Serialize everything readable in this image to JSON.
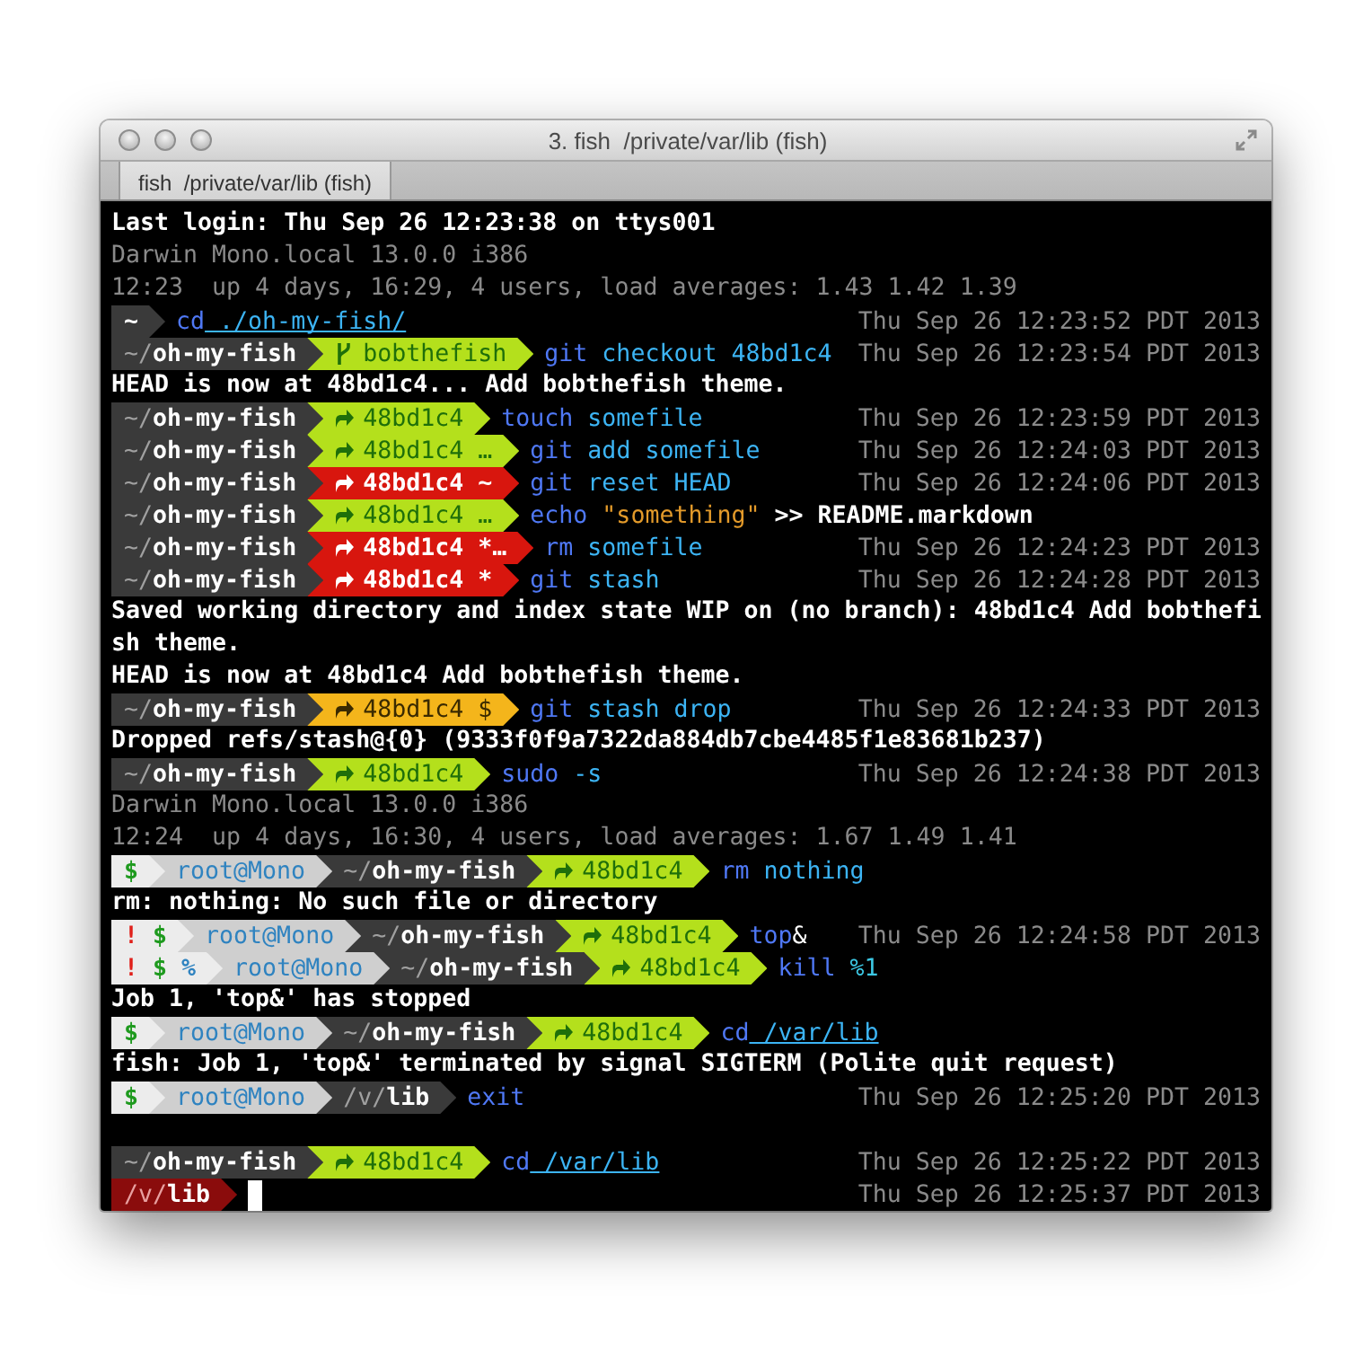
{
  "window": {
    "title": "3. fish  /private/var/lib (fish)"
  },
  "tabs": [
    {
      "label": "fish  /private/var/lib (fish)",
      "selected": true
    }
  ],
  "lines": [
    {
      "kind": "output",
      "text": "Last login: Thu Sep 26 12:23:38 on ttys001"
    },
    {
      "kind": "info",
      "text": "Darwin Mono.local 13.0.0 i386"
    },
    {
      "kind": "info",
      "text": "12:23  up 4 days, 16:29, 4 users, load averages: 1.43 1.42 1.39"
    },
    {
      "kind": "prompt",
      "segments": [
        {
          "kind": "cwd",
          "text": "**~**"
        }
      ],
      "tokens": [
        {
          "kind": "command",
          "text": "cd"
        },
        {
          "kind": "path",
          "text": " ./oh-my-fish/"
        }
      ],
      "time": "Thu Sep 26 12:23:52 PDT 2013"
    },
    {
      "kind": "prompt",
      "segments": [
        {
          "kind": "cwd",
          "text": "~/**oh-my-fish**"
        },
        {
          "kind": "git-clean",
          "detached": false,
          "text": "bobthefish"
        }
      ],
      "tokens": [
        {
          "kind": "command",
          "text": "git"
        },
        {
          "kind": "argument",
          "text": " checkout 48bd1c4"
        }
      ],
      "time": "Thu Sep 26 12:23:54 PDT 2013"
    },
    {
      "kind": "output",
      "text": "HEAD is now at 48bd1c4... Add bobthefish theme."
    },
    {
      "kind": "prompt",
      "segments": [
        {
          "kind": "cwd",
          "text": "~/**oh-my-fish**"
        },
        {
          "kind": "git-clean",
          "detached": true,
          "text": "48bd1c4"
        }
      ],
      "tokens": [
        {
          "kind": "command",
          "text": "touch"
        },
        {
          "kind": "argument",
          "text": " somefile"
        }
      ],
      "time": "Thu Sep 26 12:23:59 PDT 2013"
    },
    {
      "kind": "prompt",
      "segments": [
        {
          "kind": "cwd",
          "text": "~/**oh-my-fish**"
        },
        {
          "kind": "git-clean",
          "detached": true,
          "text": "48bd1c4 …"
        }
      ],
      "tokens": [
        {
          "kind": "command",
          "text": "git"
        },
        {
          "kind": "argument",
          "text": " add somefile"
        }
      ],
      "time": "Thu Sep 26 12:24:03 PDT 2013"
    },
    {
      "kind": "prompt",
      "segments": [
        {
          "kind": "cwd",
          "text": "~/**oh-my-fish**"
        },
        {
          "kind": "git-dirty",
          "detached": true,
          "text": "48bd1c4 ~"
        }
      ],
      "tokens": [
        {
          "kind": "command",
          "text": "git"
        },
        {
          "kind": "argument",
          "text": " reset HEAD"
        }
      ],
      "time": "Thu Sep 26 12:24:06 PDT 2013"
    },
    {
      "kind": "prompt",
      "segments": [
        {
          "kind": "cwd",
          "text": "~/**oh-my-fish**"
        },
        {
          "kind": "git-clean",
          "detached": true,
          "text": "48bd1c4 …"
        }
      ],
      "tokens": [
        {
          "kind": "command",
          "text": "echo"
        },
        {
          "kind": "string",
          "text": " \"something\""
        },
        {
          "kind": "redirect",
          "text": " >> README.markdown"
        }
      ]
    },
    {
      "kind": "prompt",
      "segments": [
        {
          "kind": "cwd",
          "text": "~/**oh-my-fish**"
        },
        {
          "kind": "git-dirty",
          "detached": true,
          "text": "48bd1c4 *…"
        }
      ],
      "tokens": [
        {
          "kind": "command",
          "text": "rm"
        },
        {
          "kind": "argument",
          "text": " somefile"
        }
      ],
      "time": "Thu Sep 26 12:24:23 PDT 2013"
    },
    {
      "kind": "prompt",
      "segments": [
        {
          "kind": "cwd",
          "text": "~/**oh-my-fish**"
        },
        {
          "kind": "git-dirty",
          "detached": true,
          "text": "48bd1c4 *"
        }
      ],
      "tokens": [
        {
          "kind": "command",
          "text": "git"
        },
        {
          "kind": "argument",
          "text": " stash"
        }
      ],
      "time": "Thu Sep 26 12:24:28 PDT 2013"
    },
    {
      "kind": "output",
      "text": "Saved working directory and index state WIP on (no branch): 48bd1c4 Add bobthefi"
    },
    {
      "kind": "output",
      "text": "sh theme."
    },
    {
      "kind": "output",
      "text": "HEAD is now at 48bd1c4 Add bobthefish theme."
    },
    {
      "kind": "prompt",
      "segments": [
        {
          "kind": "cwd",
          "text": "~/**oh-my-fish**"
        },
        {
          "kind": "git-stashed",
          "detached": true,
          "text": "48bd1c4 $"
        }
      ],
      "tokens": [
        {
          "kind": "command",
          "text": "git"
        },
        {
          "kind": "argument",
          "text": " stash drop"
        }
      ],
      "time": "Thu Sep 26 12:24:33 PDT 2013"
    },
    {
      "kind": "output",
      "text": "Dropped refs/stash@{0} (9333f0f9a7322da884db7cbe4485f1e83681b237)"
    },
    {
      "kind": "prompt",
      "segments": [
        {
          "kind": "cwd",
          "text": "~/**oh-my-fish**"
        },
        {
          "kind": "git-clean",
          "detached": true,
          "text": "48bd1c4"
        }
      ],
      "tokens": [
        {
          "kind": "command",
          "text": "sudo"
        },
        {
          "kind": "argument",
          "text": " -s"
        }
      ],
      "time": "Thu Sep 26 12:24:38 PDT 2013"
    },
    {
      "kind": "info",
      "text": "Darwin Mono.local 13.0.0 i386"
    },
    {
      "kind": "info",
      "text": "12:24  up 4 days, 16:30, 4 users, load averages: 1.67 1.49 1.41"
    },
    {
      "kind": "prompt",
      "segments": [
        {
          "kind": "status",
          "marks": [
            {
              "text": "$",
              "color": "#1e9a1e"
            }
          ]
        },
        {
          "kind": "user",
          "text": "root@Mono"
        },
        {
          "kind": "cwd",
          "text": "~/**oh-my-fish**"
        },
        {
          "kind": "git-clean",
          "detached": true,
          "text": "48bd1c4"
        }
      ],
      "tokens": [
        {
          "kind": "command",
          "text": "rm"
        },
        {
          "kind": "argument",
          "text": " nothing"
        }
      ]
    },
    {
      "kind": "output",
      "text": "rm: nothing: No such file or directory"
    },
    {
      "kind": "prompt",
      "segments": [
        {
          "kind": "status",
          "marks": [
            {
              "text": "!",
              "color": "#e0201a"
            },
            {
              "text": "$",
              "color": "#1e9a1e"
            }
          ]
        },
        {
          "kind": "user",
          "text": "root@Mono"
        },
        {
          "kind": "cwd",
          "text": "~/**oh-my-fish**"
        },
        {
          "kind": "git-clean",
          "detached": true,
          "text": "48bd1c4"
        }
      ],
      "tokens": [
        {
          "kind": "command",
          "text": "top"
        },
        {
          "kind": "operator",
          "text": "&"
        }
      ],
      "time": "Thu Sep 26 12:24:58 PDT 2013"
    },
    {
      "kind": "prompt",
      "segments": [
        {
          "kind": "status",
          "marks": [
            {
              "text": "!",
              "color": "#e0201a"
            },
            {
              "text": "$",
              "color": "#1e9a1e"
            },
            {
              "text": "%",
              "color": "#2f83c0"
            }
          ]
        },
        {
          "kind": "user",
          "text": "root@Mono"
        },
        {
          "kind": "cwd",
          "text": "~/**oh-my-fish**"
        },
        {
          "kind": "git-clean",
          "detached": true,
          "text": "48bd1c4"
        }
      ],
      "tokens": [
        {
          "kind": "command",
          "text": "kill"
        },
        {
          "kind": "job",
          "text": " %1"
        }
      ]
    },
    {
      "kind": "output",
      "text": "Job 1, 'top&' has stopped"
    },
    {
      "kind": "prompt",
      "segments": [
        {
          "kind": "status",
          "marks": [
            {
              "text": "$",
              "color": "#1e9a1e"
            }
          ]
        },
        {
          "kind": "user",
          "text": "root@Mono"
        },
        {
          "kind": "cwd",
          "text": "~/**oh-my-fish**"
        },
        {
          "kind": "git-clean",
          "detached": true,
          "text": "48bd1c4"
        }
      ],
      "tokens": [
        {
          "kind": "command",
          "text": "cd"
        },
        {
          "kind": "path",
          "text": " /var/lib"
        }
      ]
    },
    {
      "kind": "output",
      "text": "fish: Job 1, 'top&' terminated by signal SIGTERM (Polite quit request)"
    },
    {
      "kind": "prompt",
      "segments": [
        {
          "kind": "status",
          "marks": [
            {
              "text": "$",
              "color": "#1e9a1e"
            }
          ]
        },
        {
          "kind": "user",
          "text": "root@Mono"
        },
        {
          "kind": "cwd",
          "text": "/v/**lib**"
        }
      ],
      "tokens": [
        {
          "kind": "command",
          "text": "exit"
        }
      ],
      "time": "Thu Sep 26 12:25:20 PDT 2013"
    },
    {
      "kind": "blank"
    },
    {
      "kind": "prompt",
      "segments": [
        {
          "kind": "cwd",
          "text": "~/**oh-my-fish**"
        },
        {
          "kind": "git-clean",
          "detached": true,
          "text": "48bd1c4"
        }
      ],
      "tokens": [
        {
          "kind": "command",
          "text": "cd"
        },
        {
          "kind": "path",
          "text": " /var/lib"
        }
      ],
      "time": "Thu Sep 26 12:25:22 PDT 2013"
    },
    {
      "kind": "prompt",
      "segments": [
        {
          "kind": "cwd-alert",
          "text": "/v/**lib**"
        }
      ],
      "cursor": true,
      "time": "Thu Sep 26 12:25:37 PDT 2013"
    }
  ]
}
